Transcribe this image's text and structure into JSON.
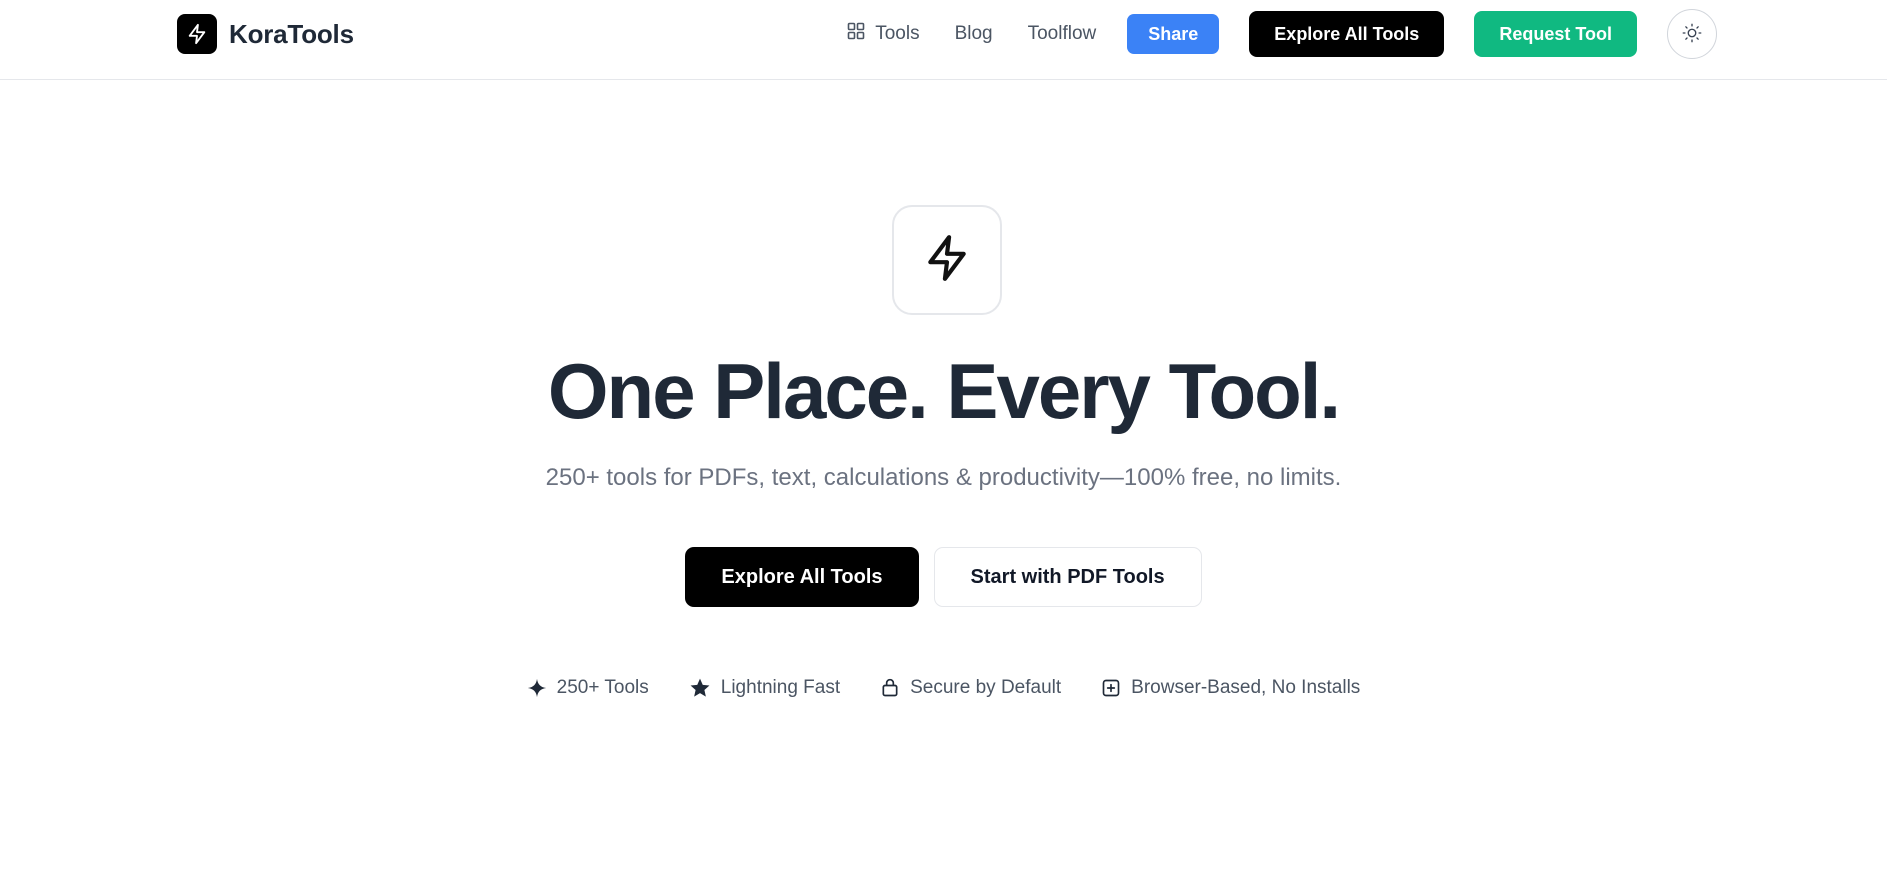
{
  "brand": {
    "name": "KoraTools",
    "logo_icon": "lightning-icon"
  },
  "nav": {
    "tools_label": "Tools",
    "tools_icon": "grid-icon",
    "blog_label": "Blog",
    "toolflow_label": "Toolflow",
    "share_label": "Share",
    "explore_label": "Explore All Tools",
    "request_label": "Request Tool",
    "theme_icon": "sun-icon"
  },
  "hero": {
    "icon": "lightning-icon",
    "title": "One Place. Every Tool.",
    "subtitle": "250+ tools for PDFs, text, calculations & productivity—100% free, no limits.",
    "primary_cta": "Explore All Tools",
    "secondary_cta": "Start with PDF Tools"
  },
  "features": [
    {
      "icon": "sparkle-icon",
      "label": "250+ Tools"
    },
    {
      "icon": "star-icon",
      "label": "Lightning Fast"
    },
    {
      "icon": "lock-icon",
      "label": "Secure by Default"
    },
    {
      "icon": "plus-square-icon",
      "label": "Browser-Based, No Installs"
    }
  ],
  "colors": {
    "share_blue": "#3b82f6",
    "request_green": "#10b981",
    "primary_black": "#000000",
    "heading": "#1f2937",
    "muted": "#6b7280"
  }
}
